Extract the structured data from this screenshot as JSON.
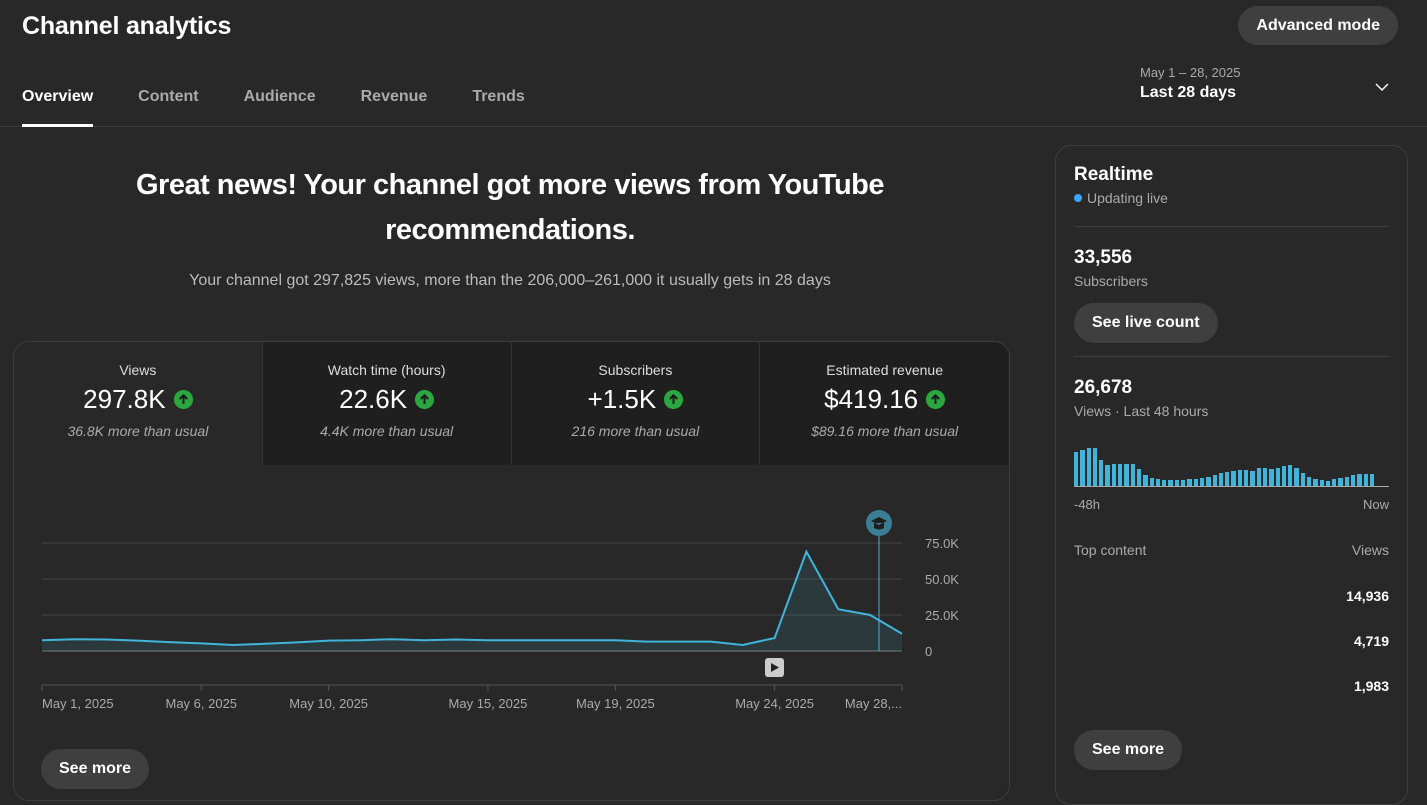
{
  "header": {
    "title": "Channel analytics",
    "advanced_mode_label": "Advanced mode",
    "tabs": [
      "Overview",
      "Content",
      "Audience",
      "Revenue",
      "Trends"
    ],
    "date_range_sub": "May 1 – 28, 2025",
    "date_range_main": "Last 28 days"
  },
  "insight": {
    "headline": "Great news! Your channel got more views from YouTube recommendations.",
    "subline": "Your channel got 297,825 views, more than the 206,000–261,000 it usually gets in 28 days"
  },
  "metrics": [
    {
      "label": "Views",
      "value": "297.8K",
      "note": "36.8K more than usual"
    },
    {
      "label": "Watch time (hours)",
      "value": "22.6K",
      "note": "4.4K more than usual"
    },
    {
      "label": "Subscribers",
      "value": "+1.5K",
      "note": "216 more than usual"
    },
    {
      "label": "Estimated revenue",
      "value": "$419.16",
      "note": "$89.16 more than usual"
    }
  ],
  "chart_data": {
    "type": "area",
    "x": [
      "May 1",
      "May 2",
      "May 3",
      "May 4",
      "May 5",
      "May 6",
      "May 7",
      "May 8",
      "May 9",
      "May 10",
      "May 11",
      "May 12",
      "May 13",
      "May 14",
      "May 15",
      "May 16",
      "May 17",
      "May 18",
      "May 19",
      "May 20",
      "May 21",
      "May 22",
      "May 23",
      "May 24",
      "May 25",
      "May 26",
      "May 27",
      "May 28"
    ],
    "values": [
      7500,
      8200,
      8000,
      7200,
      6200,
      5300,
      4200,
      5000,
      6000,
      7200,
      7500,
      8200,
      7500,
      8000,
      7500,
      7500,
      7500,
      7500,
      7500,
      6500,
      6500,
      6500,
      4200,
      9000,
      69000,
      29000,
      25000,
      12000
    ],
    "x_tick_labels": [
      "May 1, 2025",
      "May 6, 2025",
      "May 10, 2025",
      "May 15, 2025",
      "May 19, 2025",
      "May 24, 2025",
      "May 28,..."
    ],
    "x_tick_index": [
      0,
      5,
      9,
      14,
      18,
      23,
      27
    ],
    "y_ticks": [
      0,
      25000,
      50000,
      75000
    ],
    "y_tick_labels": [
      "0",
      "25.0K",
      "50.0K",
      "75.0K"
    ],
    "ylim": [
      0,
      75000
    ],
    "grid": true,
    "color": "#41b4d9"
  },
  "card_see_more": "See more",
  "realtime": {
    "title": "Realtime",
    "status": "Updating live",
    "subscribers_value": "33,556",
    "subscribers_label": "Subscribers",
    "live_count_label": "See live count",
    "views_value": "26,678",
    "views_label": "Views · Last 48 hours",
    "spark_values": [
      32,
      34,
      36,
      36,
      25,
      20,
      21,
      21,
      21,
      21,
      16,
      10,
      8,
      7,
      6,
      6,
      6,
      6,
      7,
      7,
      8,
      9,
      10,
      12,
      13,
      14,
      15,
      15,
      14,
      17,
      17,
      16,
      17,
      19,
      20,
      17,
      12,
      9,
      7,
      6,
      5,
      7,
      8,
      9,
      10,
      11,
      11,
      11
    ],
    "axis_start": "-48h",
    "axis_end": "Now",
    "top_content_label": "Top content",
    "top_views_label": "Views",
    "top_values": [
      "14,936",
      "4,719",
      "1,983"
    ],
    "see_more_label": "See more"
  }
}
